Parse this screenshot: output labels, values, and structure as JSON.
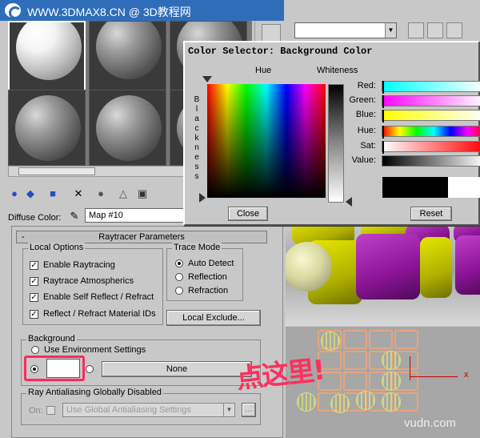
{
  "watermark": {
    "text": "WWW.3DMAX8.CN @ 3D教程网"
  },
  "icons": [
    "site-logo-icon",
    "eyedropper-icon",
    "delete-icon",
    "pick-material-icon",
    "assign-material-icon"
  ],
  "material_editor": {
    "diffuse_label": "Diffuse Color:",
    "diffuse_map": "Map #10"
  },
  "raytracer": {
    "rollout_title": "Raytracer Parameters",
    "collapse_symbol": "-",
    "local_options": {
      "title": "Local Options",
      "items": [
        {
          "label": "Enable Raytracing",
          "checked": true
        },
        {
          "label": "Raytrace Atmospherics",
          "checked": true
        },
        {
          "label": "Enable Self Reflect / Refract",
          "checked": true
        },
        {
          "label": "Reflect / Refract Material IDs",
          "checked": true
        }
      ]
    },
    "trace_mode": {
      "title": "Trace Mode",
      "options": [
        "Auto Detect",
        "Reflection",
        "Refraction"
      ],
      "selected": "Auto Detect"
    },
    "local_exclude_label": "Local Exclude...",
    "background": {
      "title": "Background",
      "use_env_label": "Use Environment Settings",
      "map_button_label": "None",
      "swatch_color": "#ffffff"
    },
    "antialias": {
      "title": "Ray Antialiasing Globally Disabled",
      "on_label": "On:",
      "selected": "Use Global Antialiasing Settings",
      "more_label": "..."
    }
  },
  "viewport": {
    "axis_label": "x",
    "site_mark": "vudn.com"
  },
  "annotation": {
    "text": "点这里!",
    "color": "#ff2f5e"
  },
  "color_selector": {
    "title": "Color Selector: Background Color",
    "hue_label": "Hue",
    "whiteness_label": "Whiteness",
    "blackness_label": "Blackness",
    "channels": [
      {
        "label": "Red:",
        "key": "red"
      },
      {
        "label": "Green:",
        "key": "green"
      },
      {
        "label": "Blue:",
        "key": "blue"
      },
      {
        "label": "Hue:",
        "key": "hue"
      },
      {
        "label": "Sat:",
        "key": "sat"
      },
      {
        "label": "Value:",
        "key": "value"
      }
    ],
    "close_label": "Close",
    "reset_label": "Reset",
    "current_color": "#ffffff",
    "original_color": "#000000"
  }
}
